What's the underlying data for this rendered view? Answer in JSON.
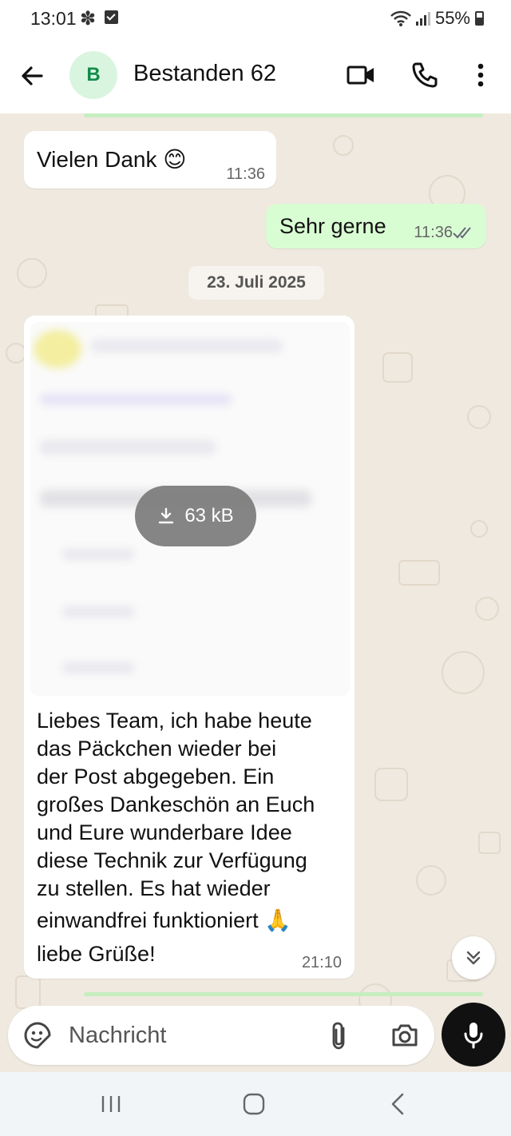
{
  "status_bar": {
    "time": "13:01",
    "battery": "55%"
  },
  "header": {
    "avatar_letter": "B",
    "title": "Bestanden 62",
    "icons": [
      "back-arrow-icon",
      "video-call-icon",
      "phone-icon",
      "more-vert-icon"
    ]
  },
  "messages": [
    {
      "direction": "in",
      "text": "Vielen Dank 😊",
      "time": "11:36"
    },
    {
      "direction": "out",
      "text": "Sehr gerne",
      "time": "11:36",
      "status": "read"
    },
    {
      "type": "date",
      "text": "23. Juli 2025"
    },
    {
      "direction": "in",
      "media_size": "63 kB",
      "lines": [
        "Liebes Team, ich habe heute",
        "das Päckchen wieder bei",
        "der Post abgegeben. Ein",
        "großes Dankeschön an Euch",
        "und Eure wunderbare Idee",
        "diese Technik zur Verfügung",
        "zu stellen. Es hat wieder",
        "einwandfrei funktioniert 🙏",
        "liebe Grüße!"
      ],
      "time": "21:10"
    }
  ],
  "composer": {
    "placeholder": "Nachricht"
  },
  "colors": {
    "accent": "#25D366",
    "chat_bg": "#efe9df",
    "outgoing": "#d9fdd3"
  }
}
